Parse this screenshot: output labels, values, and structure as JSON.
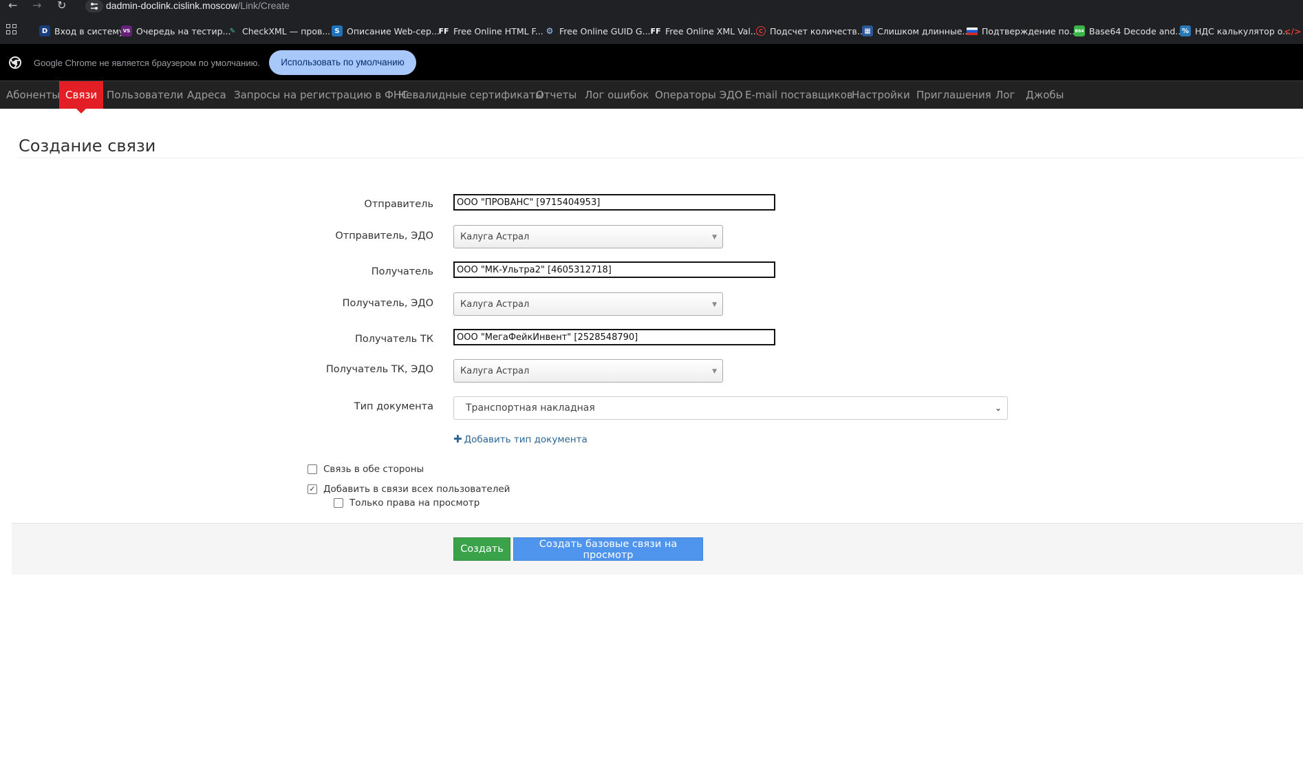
{
  "browser": {
    "url_host": "dadmin-doclink.cislink.moscow",
    "url_path": "/Link/Create",
    "bookmarks": [
      {
        "label": "Вход в систему",
        "icon": "D"
      },
      {
        "label": "Очередь на тестир...",
        "icon": "VS"
      },
      {
        "label": "CheckXML — пров...",
        "icon": "✎"
      },
      {
        "label": "Описание Web-сер...",
        "icon": "S"
      },
      {
        "label": "Free Online HTML F...",
        "icon": "FF"
      },
      {
        "label": "Free Online GUID G...",
        "icon": "⚙"
      },
      {
        "label": "Free Online XML Val...",
        "icon": "FF"
      },
      {
        "label": "Подсчет количеств...",
        "icon": "C"
      },
      {
        "label": "Слишком длинные...",
        "icon": "▦"
      },
      {
        "label": "Подтверждение по...",
        "icon": "RU"
      },
      {
        "label": "Base64 Decode and...",
        "icon": "B64"
      },
      {
        "label": "НДС калькулятор о...",
        "icon": "%"
      }
    ],
    "infobar_message": "Google Chrome не является браузером по умолчанию.",
    "infobar_button": "Использовать по умолчанию"
  },
  "nav": {
    "items": [
      "Абоненты",
      "Связи",
      "Пользователи",
      "Адреса",
      "Запросы на регистрацию в ФНС",
      "Невалидные сертификаты",
      "Отчеты",
      "Лог ошибок",
      "Операторы ЭДО",
      "E-mail поставщиков",
      "Настройки",
      "Приглашения",
      "Лог",
      "Джобы"
    ],
    "active": "Связи"
  },
  "page": {
    "title": "Создание связи"
  },
  "form": {
    "sender_label": "Отправитель",
    "sender_value": "ООО \"ПРОВАНС\" [9715404953]",
    "sender_edo_label": "Отправитель, ЭДО",
    "sender_edo_value": "Калуга Астрал",
    "receiver_label": "Получатель",
    "receiver_value": "ООО \"МК-Ультра2\" [4605312718]",
    "receiver_edo_label": "Получатель, ЭДО",
    "receiver_edo_value": "Калуга Астрал",
    "receiver_tk_label": "Получатель ТК",
    "receiver_tk_value": "ООО \"МегаФейкИнвент\" [2528548790]",
    "receiver_tk_edo_label": "Получатель ТК, ЭДО",
    "receiver_tk_edo_value": "Калуга Астрал",
    "doc_type_label": "Тип документа",
    "doc_type_value": "Транспортная накладная",
    "add_doc_type": "Добавить тип документа",
    "both_ways_label": "Связь в обе стороны",
    "both_ways_checked": false,
    "add_all_users_label": "Добавить в связи всех пользователей",
    "add_all_users_checked": true,
    "view_only_label": "Только права на просмотр",
    "view_only_checked": false,
    "create_button": "Создать",
    "create_base_button": "Создать базовые связи на просмотр"
  },
  "colors": {
    "navbar_bg": "#222222",
    "nav_active": "#e31e24",
    "create_button": "#3aa34a",
    "base_button": "#4f95ee",
    "link": "#2a6496"
  }
}
